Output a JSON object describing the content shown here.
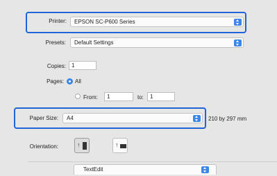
{
  "printer": {
    "label": "Printer:",
    "value": "EPSON SC-P600 Series"
  },
  "presets": {
    "label": "Presets:",
    "value": "Default Settings"
  },
  "copies": {
    "label": "Copies:",
    "value": "1"
  },
  "pages": {
    "label": "Pages:",
    "all_label": "All",
    "from_label": "From:",
    "from_value": "1",
    "to_label": "to:",
    "to_value": "1"
  },
  "paper_size": {
    "label": "Paper Size:",
    "value": "A4",
    "dims": "210 by 297 mm"
  },
  "orientation": {
    "label": "Orientation:",
    "portrait_glyph": "↑▮",
    "landscape_glyph": "↑▬"
  },
  "bottom_popup": {
    "value": "TextEdit"
  },
  "colors": {
    "accent": "#3b87e8",
    "highlight": "#1f63d6"
  }
}
